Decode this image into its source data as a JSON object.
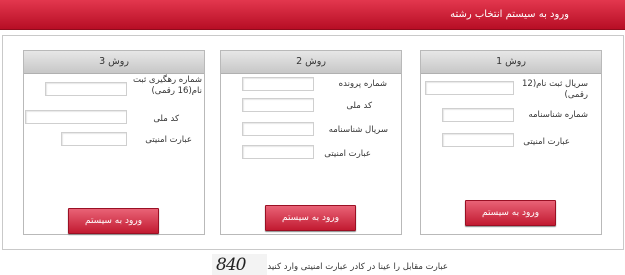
{
  "header": {
    "title": "ورود به سیستم انتخاب رشته"
  },
  "panels": [
    {
      "heading": "روش 1",
      "labels": [
        "سریال ثبت نام(12 رقمی)",
        "شماره شناسنامه",
        "عبارت امنیتی"
      ],
      "button": "ورود به سیستم"
    },
    {
      "heading": "روش 2",
      "labels": [
        "شماره پرونده",
        "کد ملی",
        "سریال شناسنامه",
        "عبارت امنیتی"
      ],
      "button": "ورود به سیستم"
    },
    {
      "heading": "روش 3",
      "labels": [
        "شماره رهگیری ثبت نام(16 رقمی)",
        "کد ملی",
        "عبارت امنیتی"
      ],
      "button": "ورود به سیستم"
    }
  ],
  "captcha": {
    "instruction": "عبارت مقابل را عینا در کادر عبارت امنیتی وارد کنید :",
    "code": "840"
  }
}
